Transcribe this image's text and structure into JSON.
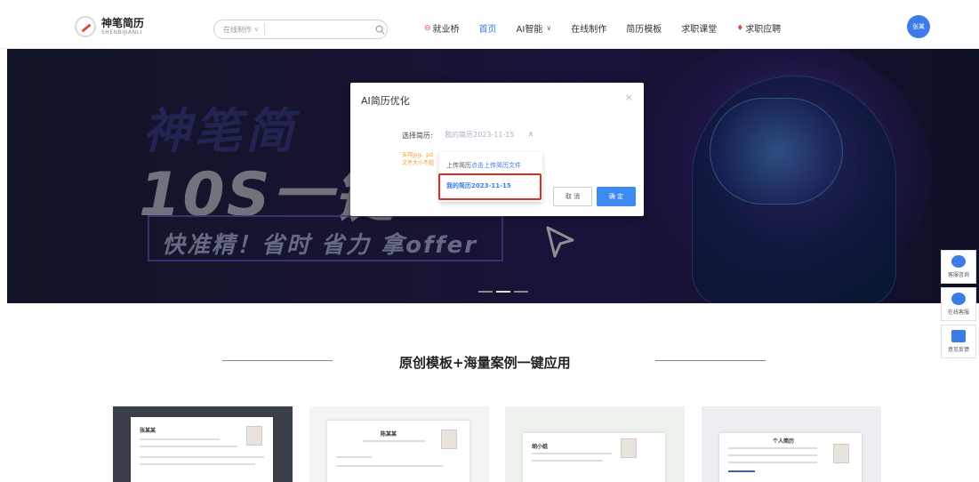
{
  "header": {
    "logo_cn": "神笔简历",
    "logo_en": "SHENBIJIANLI",
    "search_scope": "在线制作",
    "search_placeholder": "",
    "nav": [
      {
        "label": "就业桥",
        "active": false
      },
      {
        "label": "首页",
        "active": true
      },
      {
        "label": "AI智能",
        "active": false
      },
      {
        "label": "在线制作",
        "active": false
      },
      {
        "label": "简历模板",
        "active": false
      },
      {
        "label": "求职课堂",
        "active": false
      },
      {
        "label": "求职应聘",
        "active": false
      }
    ],
    "avatar_text": "张某"
  },
  "banner": {
    "title": "神笔简",
    "headline": "10S一键",
    "tagline": "快准精！省时 省力 拿offer"
  },
  "modal": {
    "title": "AI简历优化",
    "close": "×",
    "field_label": "选择简历:",
    "selected_value": "我的简历2023-11-15",
    "hint_line1": "支持jpg、pd",
    "hint_line2": "文件大小不超",
    "dropdown": {
      "upload_prefix": "上传简历",
      "upload_link": "点击上传简历文件",
      "option": "我的简历2023-11-15"
    },
    "cancel_label": "取 消",
    "ok_label": "确 定"
  },
  "section": {
    "title": "原创模板+海量案例一键应用"
  },
  "cards": [
    {
      "name": "张某某"
    },
    {
      "name": "陈某某"
    },
    {
      "name": "胡小姐"
    },
    {
      "name": "个人简历"
    }
  ],
  "side_tools": [
    {
      "label": "客服咨询",
      "icon": "headset-icon"
    },
    {
      "label": "在线客服",
      "icon": "chat-icon"
    },
    {
      "label": "意见反馈",
      "icon": "feedback-icon"
    }
  ],
  "colors": {
    "accent": "#3d7be8",
    "highlight_border": "#d93025",
    "hint": "#f39a2b"
  }
}
